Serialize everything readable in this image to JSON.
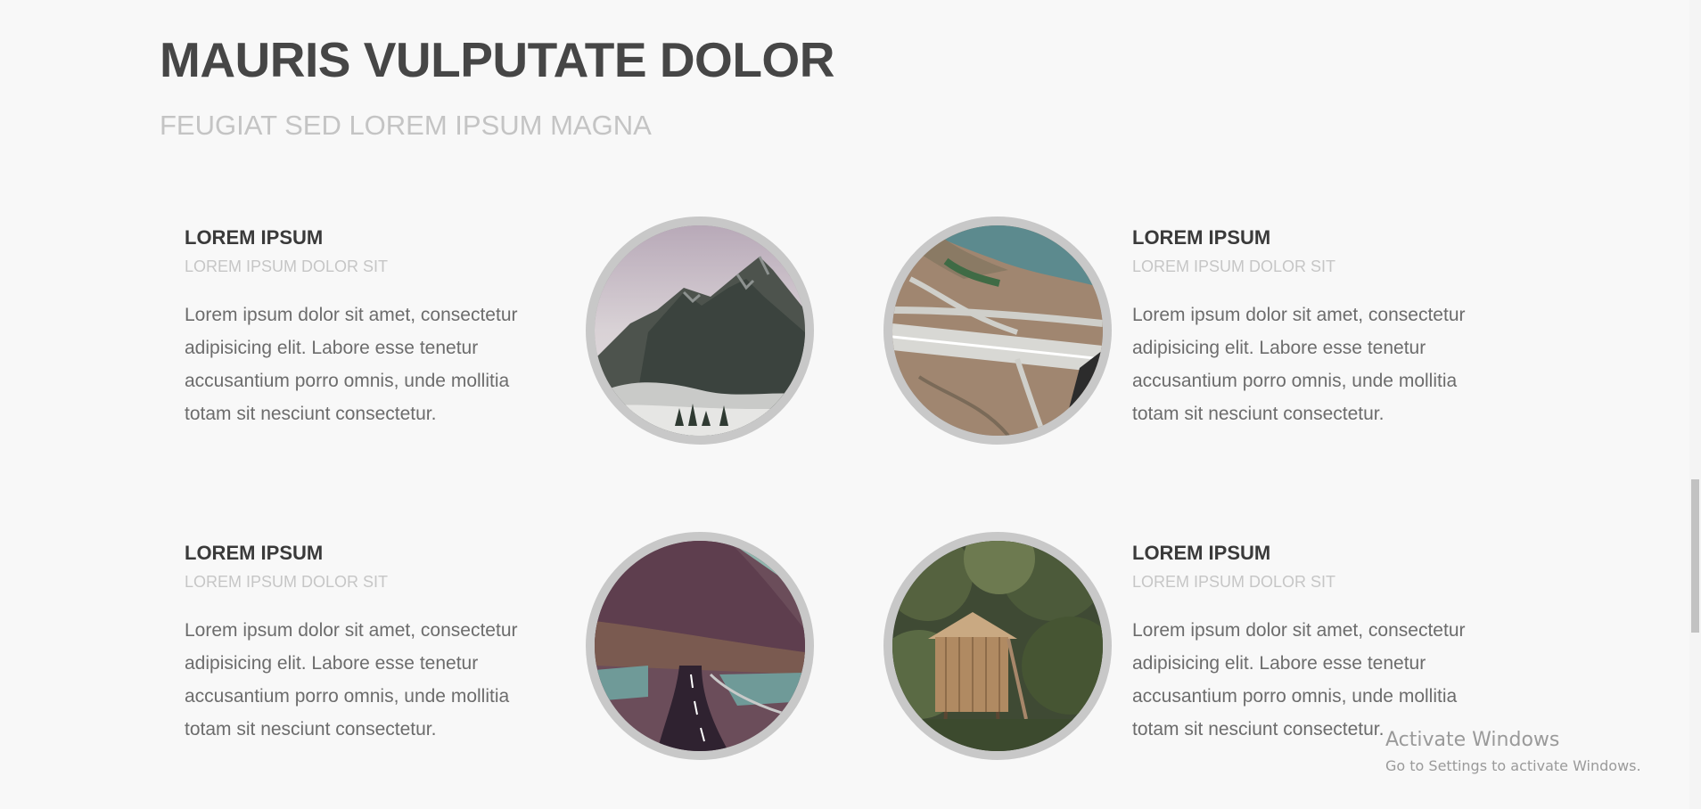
{
  "section": {
    "title": "MAURIS VULPUTATE DOLOR",
    "subtitle": "FEUGIAT SED LOREM IPSUM MAGNA"
  },
  "features": [
    {
      "title": "LOREM IPSUM",
      "subtitle": "LOREM IPSUM DOLOR SIT",
      "text": "Lorem ipsum dolor sit amet, consectetur adipisicing elit. Labore esse tenetur accusantium porro omnis, unde mollitia totam sit nesciunt consectetur.",
      "image": "mountain-photo"
    },
    {
      "title": "LOREM IPSUM",
      "subtitle": "LOREM IPSUM DOLOR SIT",
      "text": "Lorem ipsum dolor sit amet, consectetur adipisicing elit. Labore esse tenetur accusantium porro omnis, unde mollitia totam sit nesciunt consectetur.",
      "image": "highway-aerial-photo"
    },
    {
      "title": "LOREM IPSUM",
      "subtitle": "LOREM IPSUM DOLOR SIT",
      "text": "Lorem ipsum dolor sit amet, consectetur adipisicing elit. Labore esse tenetur accusantium porro omnis, unde mollitia totam sit nesciunt consectetur.",
      "image": "coastal-road-photo"
    },
    {
      "title": "LOREM IPSUM",
      "subtitle": "LOREM IPSUM DOLOR SIT",
      "text": "Lorem ipsum dolor sit amet, consectetur adipisicing elit. Labore esse tenetur accusantium porro omnis, unde mollitia totam sit nesciunt consectetur.",
      "image": "wooden-cabin-photo"
    }
  ],
  "watermark": {
    "title": "Activate Windows",
    "subtitle": "Go to Settings to activate Windows."
  },
  "colors": {
    "background": "#f8f8f8",
    "heading": "#464646",
    "subheading": "#c4c4c4",
    "body_text": "#6c6c6c",
    "photo_ring": "#c8c8c8"
  }
}
